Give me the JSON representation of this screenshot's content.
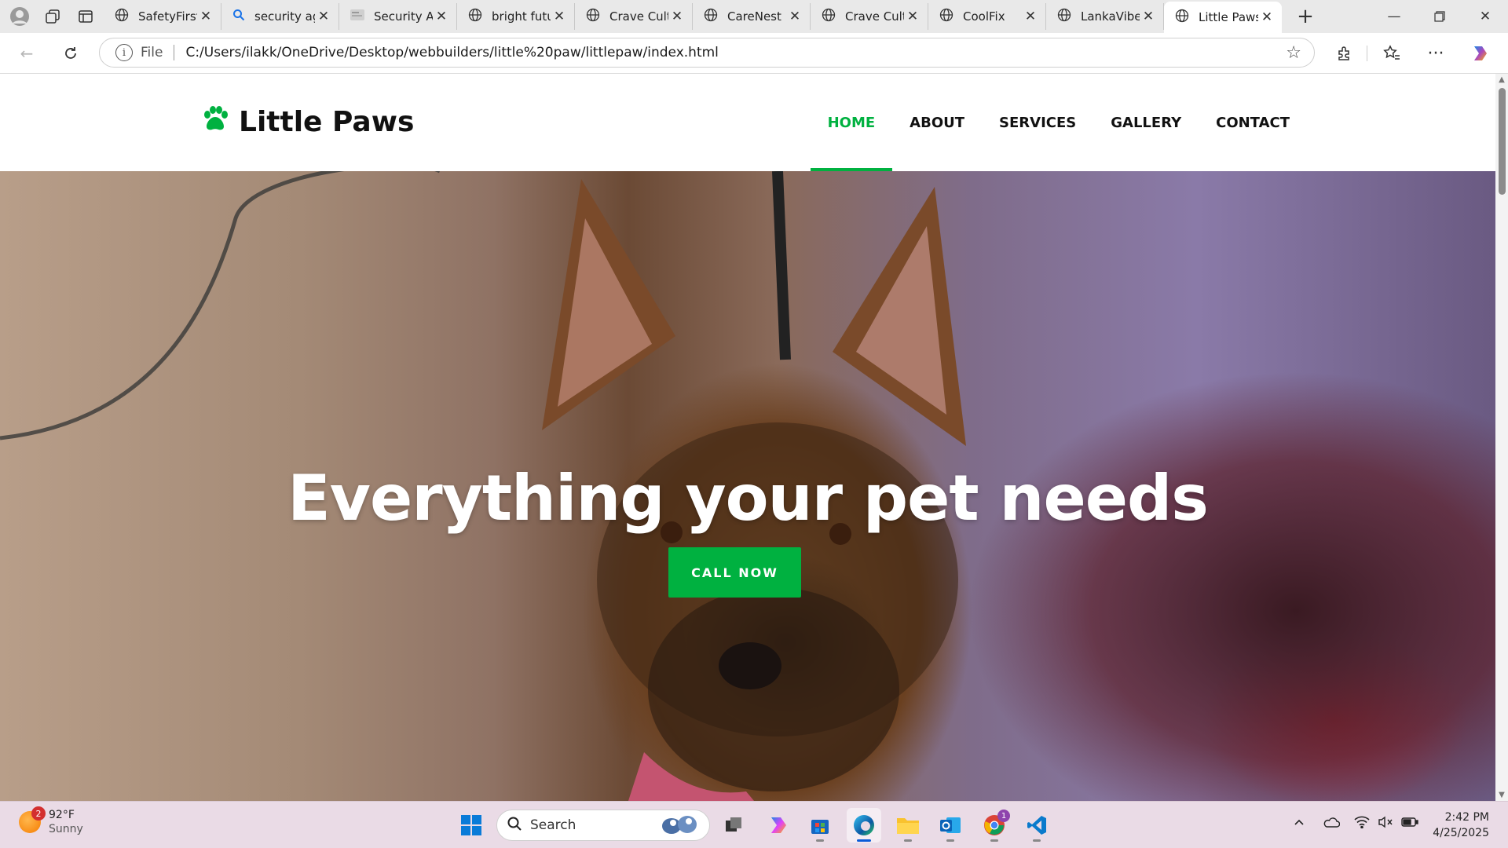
{
  "browser": {
    "tabs": [
      {
        "title": "SafetyFirst",
        "icon": "globe-icon"
      },
      {
        "title": "security ag",
        "icon": "search-icon"
      },
      {
        "title": "Security Ag",
        "icon": "page-thumbnail-icon"
      },
      {
        "title": "bright futu",
        "icon": "globe-icon"
      },
      {
        "title": "Crave Cultu",
        "icon": "globe-icon"
      },
      {
        "title": "CareNest",
        "icon": "globe-icon"
      },
      {
        "title": "Crave Cultu",
        "icon": "globe-icon"
      },
      {
        "title": "CoolFix",
        "icon": "globe-icon"
      },
      {
        "title": "LankaVibe",
        "icon": "globe-icon"
      },
      {
        "title": "Little Paws",
        "icon": "globe-icon",
        "active": true
      }
    ],
    "address": {
      "scheme_label": "File",
      "url": "C:/Users/ilakk/OneDrive/Desktop/webbuilders/little%20paw/littlepaw/index.html"
    }
  },
  "site": {
    "brand": "Little Paws",
    "accent_color": "#00b140",
    "nav": [
      {
        "label": "HOME",
        "active": true
      },
      {
        "label": "ABOUT"
      },
      {
        "label": "SERVICES"
      },
      {
        "label": "GALLERY"
      },
      {
        "label": "CONTACT"
      }
    ],
    "hero": {
      "title": "Everything your pet needs",
      "cta_label": "CALL NOW"
    }
  },
  "taskbar": {
    "weather": {
      "temp": "92°F",
      "condition": "Sunny",
      "badge": "2"
    },
    "search_placeholder": "Search",
    "chrome_badge": "1",
    "clock": {
      "time": "2:42 PM",
      "date": "4/25/2025"
    }
  }
}
